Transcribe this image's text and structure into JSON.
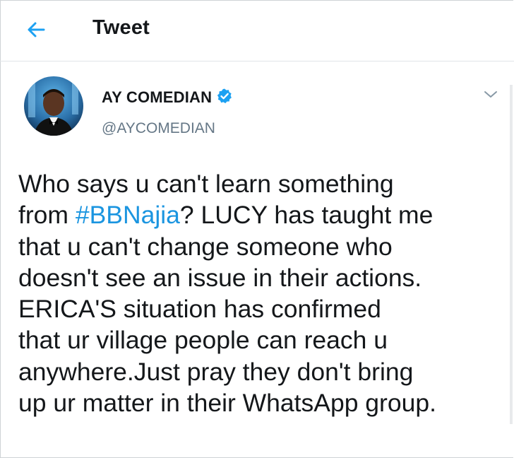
{
  "header": {
    "title": "Tweet"
  },
  "tweet": {
    "author_name": "AY COMEDIAN",
    "author_handle": "@AYCOMEDIAN",
    "verified": true,
    "text_lines": [
      {
        "before": "Who says u can't learn something",
        "hashtag": "",
        "after": ""
      },
      {
        "before": "from ",
        "hashtag": "#BBNajia",
        "after": "? LUCY has taught me"
      },
      {
        "before": "that u can't change someone who",
        "hashtag": "",
        "after": ""
      },
      {
        "before": "doesn't see an issue in their actions.",
        "hashtag": "",
        "after": ""
      },
      {
        "before": "ERICA'S situation has confirmed",
        "hashtag": "",
        "after": ""
      },
      {
        "before": "that ur village people can reach u",
        "hashtag": "",
        "after": ""
      },
      {
        "before": "anywhere.Just pray they don't bring",
        "hashtag": "",
        "after": ""
      },
      {
        "before": "up ur matter in their WhatsApp group.",
        "hashtag": "",
        "after": ""
      }
    ]
  },
  "icons": {
    "back": "arrow-left-icon",
    "verified": "verified-badge-icon",
    "menu": "chevron-down-icon"
  },
  "colors": {
    "accent": "#1da1f2",
    "hashtag": "#1b95e0",
    "text": "#14171a",
    "secondary": "#657786"
  }
}
